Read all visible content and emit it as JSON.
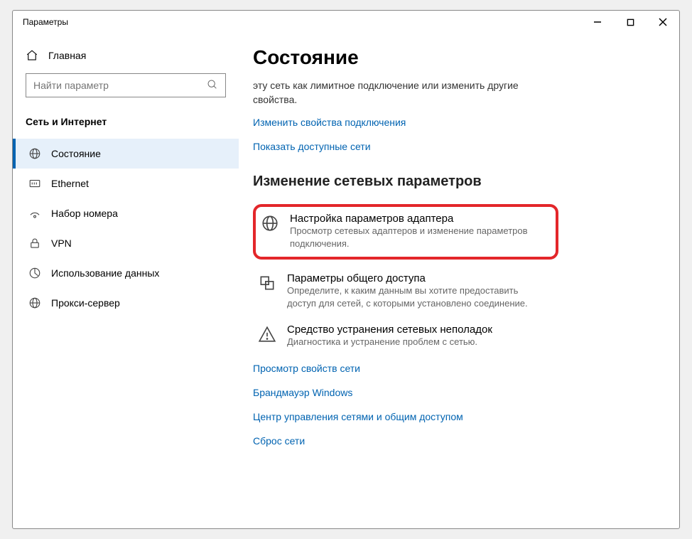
{
  "window": {
    "title": "Параметры"
  },
  "sidebar": {
    "home": "Главная",
    "search_placeholder": "Найти параметр",
    "section": "Сеть и Интернет",
    "items": [
      {
        "label": "Состояние"
      },
      {
        "label": "Ethernet"
      },
      {
        "label": "Набор номера"
      },
      {
        "label": "VPN"
      },
      {
        "label": "Использование данных"
      },
      {
        "label": "Прокси-сервер"
      }
    ]
  },
  "main": {
    "title": "Состояние",
    "intro": "эту сеть как лимитное подключение или изменить другие свойства.",
    "link_change_props": "Изменить свойства подключения",
    "link_show_networks": "Показать доступные сети",
    "section_change": "Изменение сетевых параметров",
    "options": [
      {
        "title": "Настройка параметров адаптера",
        "desc": "Просмотр сетевых адаптеров и изменение параметров подключения."
      },
      {
        "title": "Параметры общего доступа",
        "desc": "Определите, к каким данным вы хотите предоставить доступ для сетей, с которыми установлено соединение."
      },
      {
        "title": "Средство устранения сетевых неполадок",
        "desc": "Диагностика и устранение проблем с сетью."
      }
    ],
    "link_view_props": "Просмотр свойств сети",
    "link_firewall": "Брандмауэр Windows",
    "link_center": "Центр управления сетями и общим доступом",
    "link_reset": "Сброс сети"
  }
}
